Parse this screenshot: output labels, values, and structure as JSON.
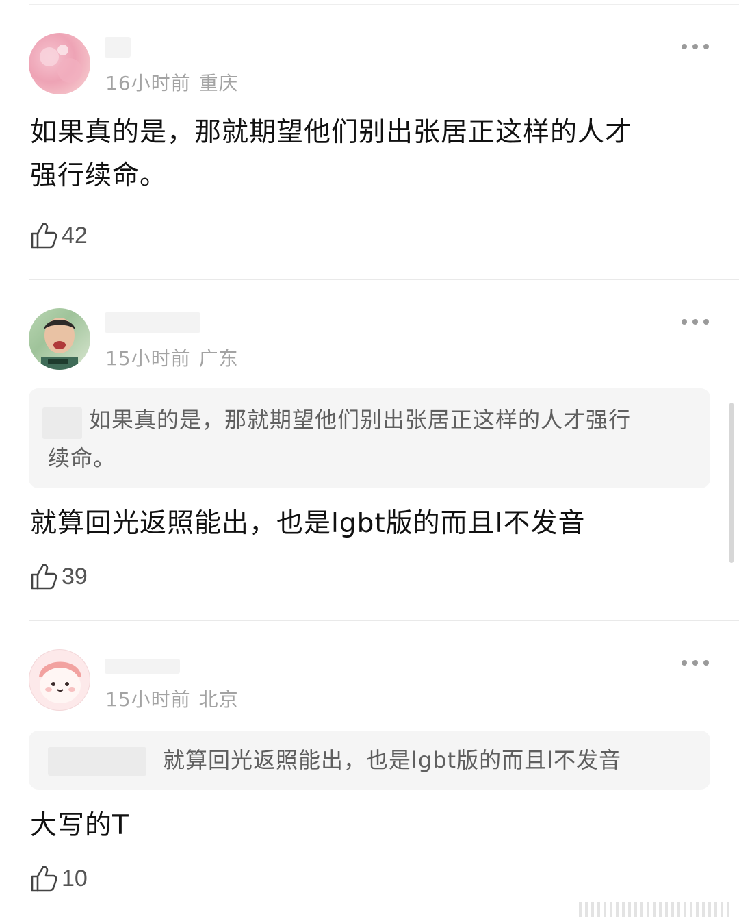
{
  "comments": [
    {
      "time": "16小时前",
      "location": "重庆",
      "text_lines": [
        "如果真的是，那就期望他们别出张居正这样的人才",
        "强行续命。"
      ],
      "likes": "42"
    },
    {
      "time": "15小时前",
      "location": "广东",
      "quote_lines": [
        "如果真的是，那就期望他们别出张居正这样的人才强行",
        "续命。"
      ],
      "text": "就算回光返照能出，也是lgbt版的而且l不发音",
      "likes": "39"
    },
    {
      "time": "15小时前",
      "location": "北京",
      "quote": "就算回光返照能出，也是lgbt版的而且l不发音",
      "text": "大写的T",
      "likes": "10"
    }
  ],
  "icons": {
    "more": "more-horizontal-icon",
    "like": "thumbs-up-icon"
  }
}
